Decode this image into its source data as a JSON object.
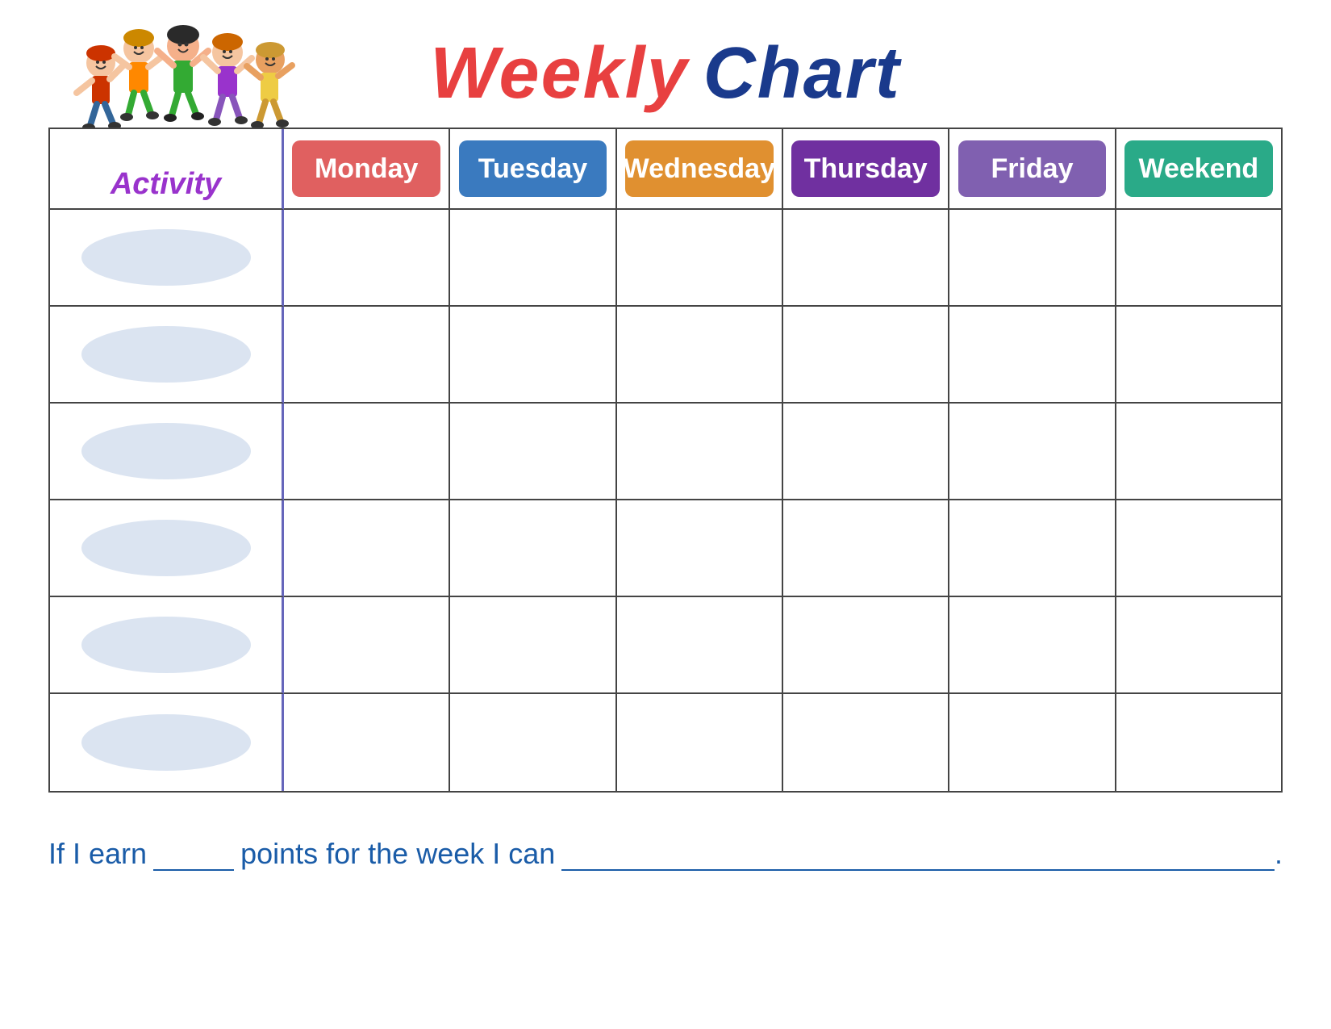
{
  "title": {
    "weekly": "Weekly",
    "chart": "Chart"
  },
  "activity_label": "Activity",
  "days": [
    {
      "label": "Monday",
      "color_class": "monday-bg"
    },
    {
      "label": "Tuesday",
      "color_class": "tuesday-bg"
    },
    {
      "label": "Wednesday",
      "color_class": "wednesday-bg"
    },
    {
      "label": "Thursday",
      "color_class": "thursday-bg"
    },
    {
      "label": "Friday",
      "color_class": "friday-bg"
    },
    {
      "label": "Weekend",
      "color_class": "weekend-bg"
    }
  ],
  "rows": 6,
  "bottom_text": {
    "prefix": "If I earn",
    "middle": "points for the week I can",
    "suffix": "."
  }
}
